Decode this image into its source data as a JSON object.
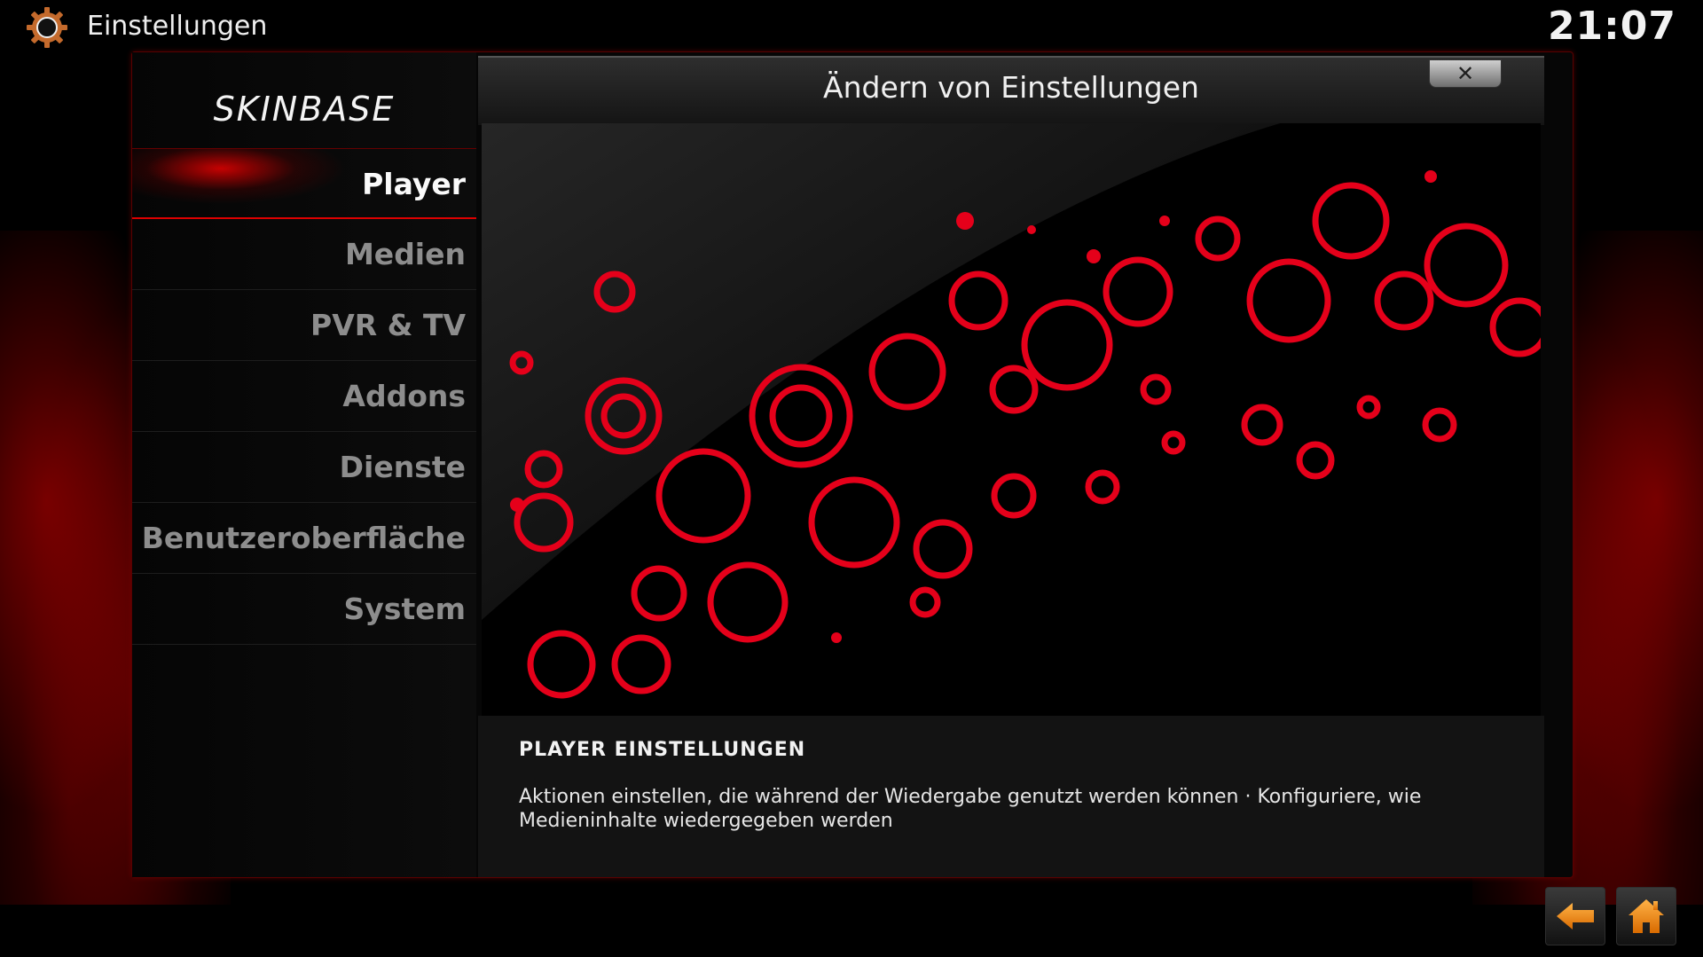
{
  "topbar": {
    "title": "Einstellungen",
    "clock": "21:07",
    "icon": "gear-icon"
  },
  "sidebar": {
    "brand": "SKINBASE",
    "items": [
      {
        "label": "Player",
        "active": true
      },
      {
        "label": "Medien",
        "active": false
      },
      {
        "label": "PVR & TV",
        "active": false
      },
      {
        "label": "Addons",
        "active": false
      },
      {
        "label": "Dienste",
        "active": false
      },
      {
        "label": "Benutzeroberfläche",
        "active": false
      },
      {
        "label": "System",
        "active": false
      }
    ]
  },
  "content": {
    "title": "Ändern von Einstellungen",
    "close_label": "✕",
    "description_title": "PLAYER EINSTELLUNGEN",
    "description_text": "Aktionen einstellen, die während der Wiedergabe genutzt werden können · Konfiguriere, wie Medieninhalte wiedergegeben werden"
  },
  "footer": {
    "back_icon": "back-arrow-icon",
    "home_icon": "home-icon"
  },
  "colors": {
    "accent": "#e00000",
    "background": "#000000",
    "text_inactive": "#8d8d8d",
    "text_active": "#fafafa"
  }
}
